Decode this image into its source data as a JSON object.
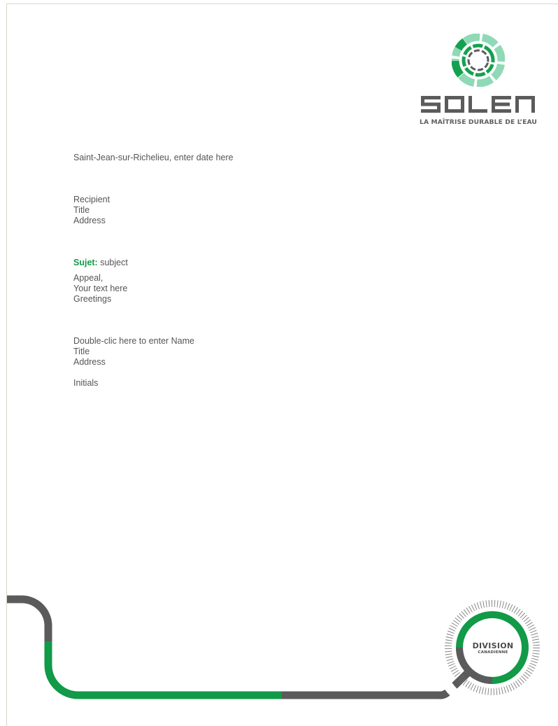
{
  "header": {
    "logo_icon": "soleno-segmented-ring-icon",
    "brand_name": "SOLENO",
    "tagline": "LA MAÎTRISE DURABLE DE L’EAU"
  },
  "letter": {
    "date_line": "Saint-Jean-sur-Richelieu, enter date here",
    "recipient": {
      "name": "Recipient",
      "title": "Title",
      "address": "Address"
    },
    "subject": {
      "label": "Sujet:",
      "value": " subject"
    },
    "body": {
      "appeal": "Appeal,",
      "text": "Your text here",
      "greetings": "Greetings"
    },
    "signature": {
      "name": "Double-clic here to enter Name",
      "title": "Title",
      "address": "Address"
    },
    "initials": "Initials"
  },
  "footer": {
    "division_title": "DIVISION",
    "division_sub": "CANADIENNE",
    "decoration_icon": "pipeline-track-icon"
  },
  "colors": {
    "brand_green": "#119a47",
    "light_green": "#7fd4ad",
    "dark_gray": "#5b5b5b",
    "text_gray": "#555555",
    "page_edge": "#d9d6c8"
  }
}
